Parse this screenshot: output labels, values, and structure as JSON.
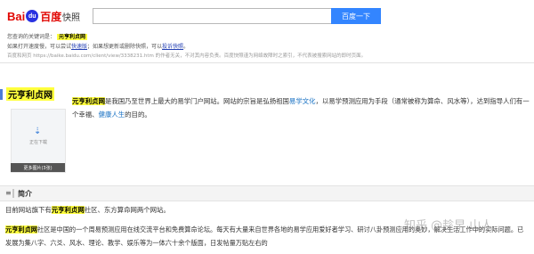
{
  "header": {
    "logo_latin": "Bai",
    "logo_paw": "du",
    "logo_cn": "百度",
    "snapshot_label": "快照",
    "search_value": "",
    "search_button": "百度一下"
  },
  "notice": {
    "keyword_prefix": "您查询的关键词是：",
    "keyword": "元亨利贞网",
    "line2_a": "如果打开速度慢，可以尝试",
    "line2_link1": "快速版",
    "line2_b": "；如果想更新或删除快照，可以",
    "line2_link2": "投诉快照",
    "line2_c": "。",
    "line3_a": "百度和网页 ",
    "line3_url": "https://baike.baidu.com/client/view/3338231.htm",
    "line3_b": " 的作者无关，不对其内容负责。百度快照谨为网络故障时之索引，不代表被搜索网站的即时页面。"
  },
  "article": {
    "title": "元亨利贞网",
    "thumb_text": "正在下载",
    "thumb_more": "更多图片(3张)",
    "intro": {
      "name": "元亨利贞网",
      "t1": "是我国乃至世界上最大的易学门户网站。网站的宗旨是弘扬祖国",
      "link1": "易学文化",
      "t2": "，以易学预测应用为手段（通常被称为算命、风水等），达到指导人们有一个幸福、",
      "link2": "健康人生",
      "t3": "的目的。"
    },
    "section_label": "简介",
    "p1_a": "目前网站旗下有",
    "p1_name": "元亨利贞网",
    "p1_b": "社区、东方算命网两个网站。",
    "p2_name": "元亨利贞网",
    "p2_text": "社区是中国的一个周易预测应用在线交流平台和免费算命论坛。每天有大量来自世界各地的易学应用爱好者学习、研讨八卦预测应用的奥妙，解决生活工作中的实际问题。已发展为集八字、六爻、风水、理论、教学、娱乐等为一体六十余个版面，日发帖量万贴左右的",
    "watermark": "知乎 @趁早 山人"
  },
  "colors": {
    "accent": "#3385ff",
    "highlight": "#ffff3d",
    "link": "#136ec2"
  },
  "icons": [
    "baidu-paw-icon",
    "list-icon",
    "image-placeholder-icon"
  ]
}
